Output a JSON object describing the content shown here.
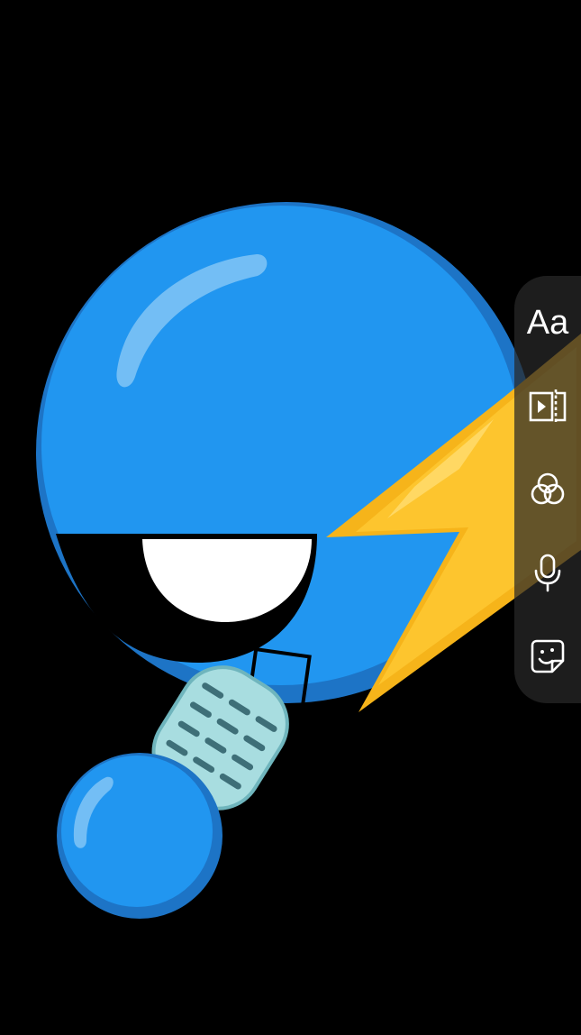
{
  "toolbar": {
    "text_tool_label": "Aa",
    "items": [
      {
        "name": "text-tool",
        "icon": "text-aa-icon"
      },
      {
        "name": "trim-tool",
        "icon": "trim-video-icon"
      },
      {
        "name": "filters-tool",
        "icon": "filters-circles-icon"
      },
      {
        "name": "voiceover-tool",
        "icon": "microphone-icon"
      },
      {
        "name": "stickers-tool",
        "icon": "sticker-smile-icon"
      }
    ]
  },
  "artwork": {
    "subject": "blue-emoji-singing-with-microphone-and-lightning",
    "colors": {
      "background": "#000000",
      "emoji_blue": "#2196F0",
      "emoji_dark_blue": "#1A78C8",
      "lightning_yellow": "#F6B41A",
      "mic_cyan": "#A8DDE0",
      "mic_dark": "#3E6F78"
    }
  }
}
